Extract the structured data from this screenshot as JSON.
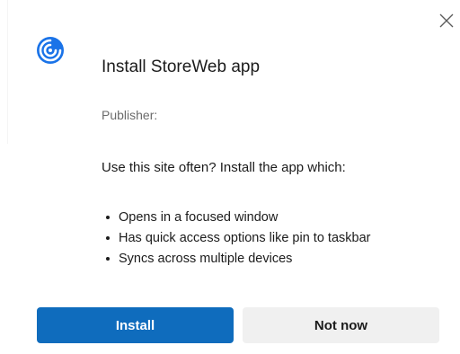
{
  "dialog": {
    "title": "Install StoreWeb app",
    "publisher_label": "Publisher:",
    "description": "Use this site often? Install the app which:",
    "features": [
      "Opens in a focused window",
      "Has quick access options like pin to taskbar",
      "Syncs across multiple devices"
    ],
    "install_label": "Install",
    "not_now_label": "Not now",
    "icons": {
      "close": "close-icon",
      "app": "storeweb-app-icon"
    },
    "colors": {
      "accent": "#0f6cbd",
      "secondary_button": "#f0f0f0",
      "muted_text": "#6b6b6b",
      "text": "#1b1b1b",
      "app_icon": "#1a73e8"
    }
  }
}
